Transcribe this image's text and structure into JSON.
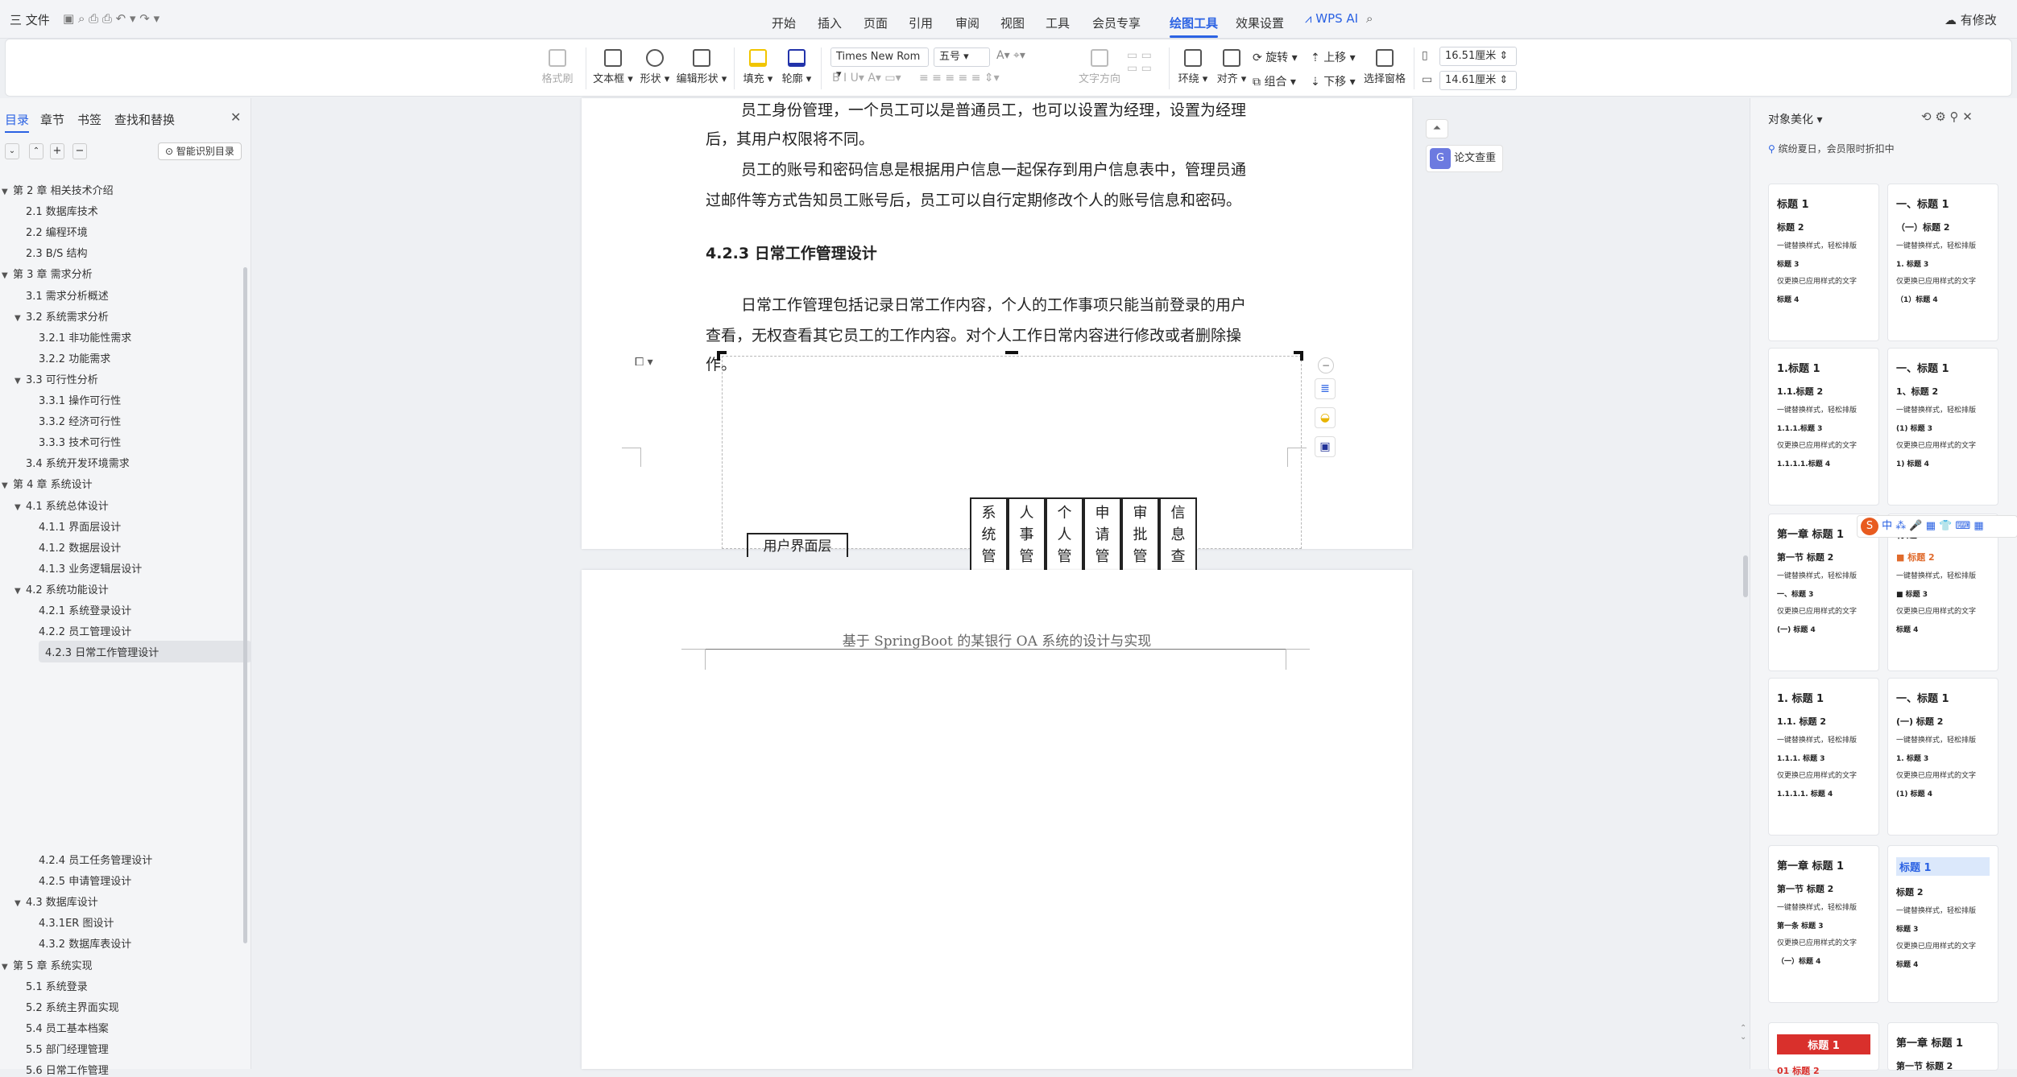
{
  "titlebar": {
    "file_menu": "三 文件",
    "menu": [
      "开始",
      "插入",
      "页面",
      "引用",
      "审阅",
      "视图",
      "工具",
      "会员专享",
      "绘图工具",
      "效果设置"
    ],
    "active_menu": "绘图工具",
    "wps_ai": "WPS AI",
    "status": "有修改"
  },
  "ribbon": {
    "format_painter": "格式刷",
    "textbox": "文本框",
    "shape": "形状",
    "edit_shape": "编辑形状",
    "fill": "填充",
    "outline": "轮廓",
    "font_name": "Times New Rom",
    "font_size": "五号",
    "text_direction": "文字方向",
    "wrap": "环绕",
    "align": "对齐",
    "rotate": "旋转",
    "group": "组合",
    "bring_forward": "上移",
    "send_backward": "下移",
    "selection_pane": "选择窗格",
    "width": "16.51厘米",
    "height": "14.61厘米"
  },
  "leftpanel": {
    "tabs": [
      "目录",
      "章节",
      "书签",
      "查找和替换"
    ],
    "smart_toc": "智能识别目录",
    "toc": [
      {
        "level": 1,
        "label": "第 2 章  相关技术介绍",
        "tri": true
      },
      {
        "level": 2,
        "label": "2.1  数据库技术"
      },
      {
        "level": 2,
        "label": "2.2  编程环境"
      },
      {
        "level": 2,
        "label": "2.3 B/S 结构"
      },
      {
        "level": 1,
        "label": "第 3 章  需求分析",
        "tri": true
      },
      {
        "level": 2,
        "label": "3.1  需求分析概述"
      },
      {
        "level": 2,
        "label": "3.2  系统需求分析",
        "tri": true
      },
      {
        "level": 3,
        "label": "3.2.1 非功能性需求"
      },
      {
        "level": 3,
        "label": "3.2.2 功能需求"
      },
      {
        "level": 2,
        "label": "3.3  可行性分析",
        "tri": true
      },
      {
        "level": 3,
        "label": "3.3.1 操作可行性"
      },
      {
        "level": 3,
        "label": "3.3.2 经济可行性"
      },
      {
        "level": 3,
        "label": "3.3.3 技术可行性"
      },
      {
        "level": 2,
        "label": "3.4  系统开发环境需求"
      },
      {
        "level": 1,
        "label": "第 4 章  系统设计",
        "tri": true
      },
      {
        "level": 2,
        "label": "4.1 系统总体设计",
        "tri": true
      },
      {
        "level": 3,
        "label": "4.1.1 界面层设计"
      },
      {
        "level": 3,
        "label": "4.1.2 数据层设计"
      },
      {
        "level": 3,
        "label": "4.1.3 业务逻辑层设计"
      },
      {
        "level": 2,
        "label": "4.2 系统功能设计",
        "tri": true
      },
      {
        "level": 3,
        "label": "4.2.1 系统登录设计"
      },
      {
        "level": 3,
        "label": "4.2.2 员工管理设计"
      },
      {
        "level": 3,
        "label": "4.2.3 日常工作管理设计",
        "selected": true
      }
    ],
    "toc2": [
      {
        "level": 3,
        "label": "4.2.4 员工任务管理设计"
      },
      {
        "level": 3,
        "label": "4.2.5 申请管理设计"
      },
      {
        "level": 2,
        "label": "4.3  数据库设计",
        "tri": true
      },
      {
        "level": 3,
        "label": "4.3.1ER 图设计"
      },
      {
        "level": 3,
        "label": "4.3.2 数据库表设计"
      },
      {
        "level": 1,
        "label": "第 5 章  系统实现",
        "tri": true
      },
      {
        "level": 2,
        "label": "5.1 系统登录"
      },
      {
        "level": 2,
        "label": "5.2 系统主界面实现"
      },
      {
        "level": 2,
        "label": "5.4 员工基本档案"
      },
      {
        "level": 2,
        "label": "5.5 部门经理管理"
      },
      {
        "level": 2,
        "label": "5.6 日常工作管理"
      }
    ]
  },
  "document": {
    "p1_line1": "员工身份管理，一个员工可以是普通员工，也可以设置为经理，设置为经理",
    "p1_line2": "后，其用户权限将不同。",
    "p2_line1": "员工的账号和密码信息是根据用户信息一起保存到用户信息表中，管理员通",
    "p2_line2": "过邮件等方式告知员工账号后，员工可以自行定期修改个人的账号信息和密码。",
    "heading": "4.2.3 日常工作管理设计",
    "p3_line1": "日常工作管理包括记录日常工作内容，个人的工作事项只能当前登录的用户",
    "p3_line2": "查看，无权查看其它员工的工作内容。对个人工作日常内容进行修改或者删除操",
    "p3_line3": "作。",
    "diagram_boxes": [
      "系统管理",
      "人事管理",
      "个人管理",
      "申请管理",
      "审批管理",
      "信息查询"
    ],
    "user_layer": "用户界面层",
    "header2": "基于 SpringBoot 的某银行 OA 系统的设计与实现",
    "paper_check": "论文查重"
  },
  "rightpanel": {
    "title": "对象美化",
    "promo": "缤纷夏日，会员限时折扣中",
    "cards": [
      {
        "h1": "标题 1",
        "h2": "标题 2",
        "t1": "一键替换样式，轻松排版",
        "h3": "标题 3",
        "t2": "仅更换已应用样式的文字",
        "h4": "标题 4"
      },
      {
        "h1": "一、标题 1",
        "h2": "（一）标题 2",
        "t1": "一键替换样式，轻松排版",
        "h3": "1. 标题 3",
        "t2": "仅更换已应用样式的文字",
        "h4": "（1）标题 4"
      },
      {
        "h1": "1.标题 1",
        "h2": "1.1.标题 2",
        "t1": "一键替换样式，轻松排版",
        "h3": "1.1.1.标题 3",
        "t2": "仅更换已应用样式的文字",
        "h4": "1.1.1.1.标题 4"
      },
      {
        "h1": "一、标题 1",
        "h2": "1、标题 2",
        "t1": "一键替换样式，轻松排版",
        "h3": "(1) 标题 3",
        "t2": "仅更换已应用样式的文字",
        "h4": "1) 标题 4"
      },
      {
        "h1": "第一章  标题 1",
        "h2": "第一节  标题 2",
        "t1": "一键替换样式，轻松排版",
        "h3": "一、标题 3",
        "t2": "仅更换已应用样式的文字",
        "h4": "(一) 标题 4"
      },
      {
        "h1": "标题 1",
        "h2": "■ 标题 2",
        "t1": "一键替换样式，轻松排版",
        "h3": "■ 标题 3",
        "t2": "仅更换已应用样式的文字",
        "h4": "标题 4"
      },
      {
        "h1": "1. 标题 1",
        "h2": "1.1. 标题 2",
        "t1": "一键替换样式，轻松排版",
        "h3": "1.1.1. 标题 3",
        "t2": "仅更换已应用样式的文字",
        "h4": "1.1.1.1. 标题 4"
      },
      {
        "h1": "一、标题 1",
        "h2": "(一) 标题 2",
        "t1": "一键替换样式，轻松排版",
        "h3": "1. 标题 3",
        "t2": "仅更换已应用样式的文字",
        "h4": "(1) 标题 4"
      },
      {
        "h1": "第一章   标题 1",
        "h2": "第一节   标题 2",
        "t1": "一键替换样式，轻松排版",
        "h3": "第一条   标题 3",
        "t2": "仅更换已应用样式的文字",
        "h4": "（一）标题 4"
      },
      {
        "h1": "标题 1",
        "h2": "标题 2",
        "t1": "一键替换样式，轻松排版",
        "h3": "标题 3",
        "t2": "仅更换已应用样式的文字",
        "h4": "标题 4"
      },
      {
        "h1": "标题 1",
        "h2": "01 标题 2"
      },
      {
        "h1": "第一章   标题 1",
        "h2": "第一节   标题 2"
      }
    ]
  },
  "ime": "中"
}
